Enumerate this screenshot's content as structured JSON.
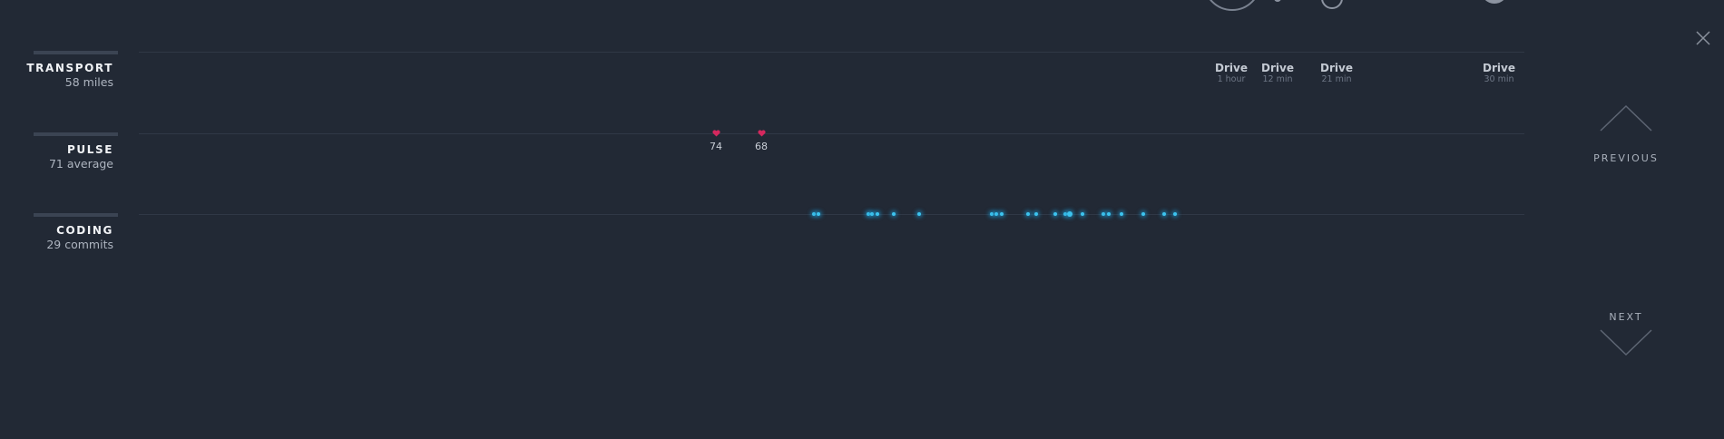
{
  "rows": [
    {
      "title": "TRANSPORT",
      "subtitle": "58 miles"
    },
    {
      "title": "PULSE",
      "subtitle": "71 average"
    },
    {
      "title": "CODING",
      "subtitle": "29 commits"
    }
  ],
  "transport": {
    "drives": [
      {
        "label": "Drive",
        "duration": "1 hour"
      },
      {
        "label": "Drive",
        "duration": "12 min"
      },
      {
        "label": "Drive",
        "duration": "21 min"
      },
      {
        "label": "Drive",
        "duration": "30 min"
      }
    ]
  },
  "pulse": {
    "readings": [
      {
        "value": "74"
      },
      {
        "value": "68"
      }
    ],
    "color": "#d4285e"
  },
  "coding": {
    "commit_color": "#3cc3ee"
  },
  "nav": {
    "previous": "PREVIOUS",
    "next": "NEXT"
  },
  "icons": {
    "close": "close-icon",
    "heart": "heart-icon",
    "up": "chevron-up-icon",
    "down": "chevron-down-icon"
  }
}
